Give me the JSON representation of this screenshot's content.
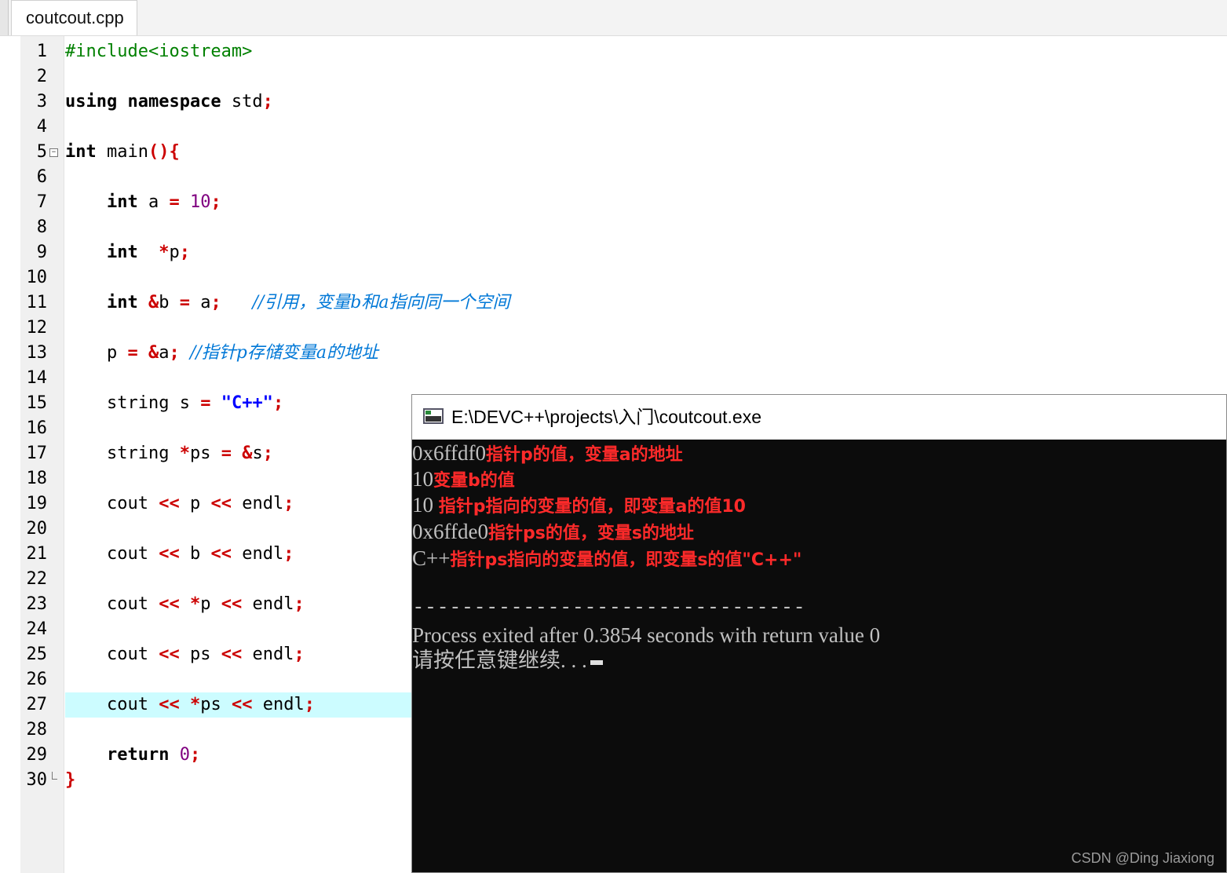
{
  "tab": {
    "label": "coutcout.cpp"
  },
  "line_numbers": [
    "1",
    "2",
    "3",
    "4",
    "5",
    "6",
    "7",
    "8",
    "9",
    "10",
    "11",
    "12",
    "13",
    "14",
    "15",
    "16",
    "17",
    "18",
    "19",
    "20",
    "21",
    "22",
    "23",
    "24",
    "25",
    "26",
    "27",
    "28",
    "29",
    "30"
  ],
  "code": {
    "l1": "#include<iostream>",
    "l3_kw": "using namespace",
    "l3_id": " std",
    "l5_kw": "int",
    "l5_id": " main",
    "l7_kw": "int",
    "l7_id": " a ",
    "l7_num": "10",
    "l9_kw": "int",
    "l9_id": "p",
    "l11_kw": "int",
    "l11_b": "b ",
    "l11_a": " a",
    "l11_cmt": "//引用，变量b和a指向同一个空间",
    "l13_p": "p ",
    "l13_a": "a",
    "l13_cmt": "//指针p存储变量a的地址",
    "l15_id": "string s ",
    "l15_str": "\"C++\"",
    "l17_id": "string ",
    "l17_ps": "ps ",
    "l17_s": "s",
    "cout": "cout ",
    "l19_p": " p ",
    "endl": " endl",
    "l21_b": " b ",
    "l23_p": "p ",
    "l25_ps": " ps ",
    "l27_ps": "ps ",
    "l29_kw": "return",
    "l29_num": "0"
  },
  "console": {
    "title": "E:\\DEVC++\\projects\\入门\\coutcout.exe",
    "lines": [
      {
        "text": "0x6ffdf0",
        "note": "指针p的值，变量a的地址"
      },
      {
        "text": "10",
        "note": "变量b的值"
      },
      {
        "text": "10 ",
        "note": "指针p指向的变量的值，即变量a的值10"
      },
      {
        "text": "0x6ffde0",
        "note": "指针ps的值，变量s的地址"
      },
      {
        "text": "C++",
        "note": "指针ps指向的变量的值，即变量s的值\"C++\""
      }
    ],
    "separator": "--------------------------------",
    "process": "Process exited after 0.3854 seconds with return value 0",
    "prompt": "请按任意键继续. . ."
  },
  "watermark": "CSDN @Ding Jiaxiong"
}
